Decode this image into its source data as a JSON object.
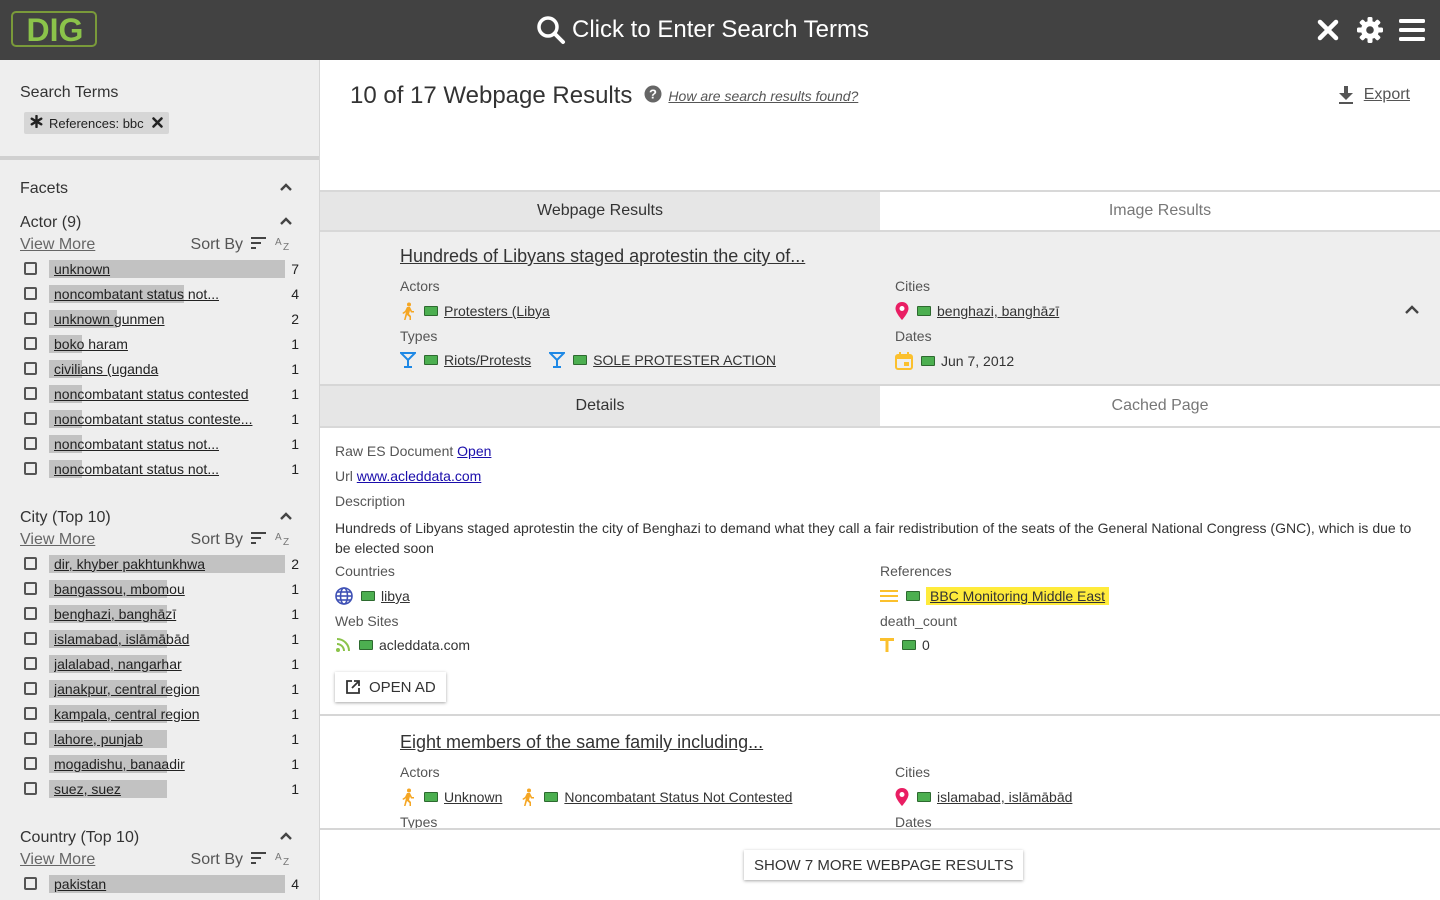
{
  "app": {
    "logo_text": "DIG"
  },
  "header": {
    "search_prompt": "Click to Enter Search Terms"
  },
  "sidebar": {
    "search_terms_title": "Search Terms",
    "chip_label": "References: bbc",
    "facets_title": "Facets",
    "sort_by_label": "Sort By",
    "view_more_label": "View More",
    "actor": {
      "title": "Actor (9)",
      "items": [
        {
          "label": "unknown",
          "count": "7",
          "fraction": 1.0
        },
        {
          "label": "noncombatant status not...",
          "count": "4",
          "fraction": 0.57
        },
        {
          "label": "unknown gunmen",
          "count": "2",
          "fraction": 0.29
        },
        {
          "label": "boko haram",
          "count": "1",
          "fraction": 0.14
        },
        {
          "label": "civilians (uganda",
          "count": "1",
          "fraction": 0.14
        },
        {
          "label": "noncombatant status contested",
          "count": "1",
          "fraction": 0.14
        },
        {
          "label": "noncombatant status conteste...",
          "count": "1",
          "fraction": 0.14
        },
        {
          "label": "noncombatant status not...",
          "count": "1",
          "fraction": 0.14
        },
        {
          "label": "noncombatant status not...",
          "count": "1",
          "fraction": 0.14
        }
      ]
    },
    "city": {
      "title": "City (Top 10)",
      "items": [
        {
          "label": "dir, khyber pakhtunkhwa",
          "count": "2",
          "fraction": 1.0
        },
        {
          "label": "bangassou, mbomou",
          "count": "1",
          "fraction": 0.5
        },
        {
          "label": "benghazi, banghāzī",
          "count": "1",
          "fraction": 0.5
        },
        {
          "label": "islamabad, islāmābād",
          "count": "1",
          "fraction": 0.5
        },
        {
          "label": "jalalabad, nangarhar",
          "count": "1",
          "fraction": 0.5
        },
        {
          "label": "janakpur, central region",
          "count": "1",
          "fraction": 0.5
        },
        {
          "label": "kampala, central region",
          "count": "1",
          "fraction": 0.5
        },
        {
          "label": "lahore, punjab",
          "count": "1",
          "fraction": 0.5
        },
        {
          "label": "mogadishu, banaadir",
          "count": "1",
          "fraction": 0.5
        },
        {
          "label": "suez, suez",
          "count": "1",
          "fraction": 0.5
        }
      ]
    },
    "country": {
      "title": "Country (Top 10)",
      "items": [
        {
          "label": "pakistan",
          "count": "4",
          "fraction": 1.0
        }
      ]
    }
  },
  "main": {
    "results_title": "10 of 17 Webpage Results",
    "help_link": "How are search results found?",
    "export_label": "Export",
    "tabs": {
      "webpage": "Webpage Results",
      "image": "Image Results"
    },
    "result1": {
      "title": "Hundreds of Libyans staged aprotestin the city of...",
      "actors_label": "Actors",
      "actor_value": "Protesters (Libya",
      "types_label": "Types",
      "type_1": "Riots/Protests",
      "type_2": "SOLE PROTESTER ACTION",
      "cities_label": "Cities",
      "city_value": "benghazi, banghāzī",
      "dates_label": "Dates",
      "date_value": "Jun 7, 2012"
    },
    "detail_tabs": {
      "details": "Details",
      "cached": "Cached Page"
    },
    "details": {
      "raw_label": "Raw ES Document",
      "raw_link": "Open",
      "url_label": "Url",
      "url_value": "www.acleddata.com",
      "description_label": "Description",
      "description": "Hundreds of Libyans staged aprotestin the city of Benghazi to demand what they call a fair redistribution of the seats of the General National Congress (GNC), which is due to be elected soon",
      "countries_label": "Countries",
      "country_value": "libya",
      "references_label": "References",
      "reference_value": "BBC Monitoring Middle East",
      "websites_label": "Web Sites",
      "website_value": "acleddata.com",
      "death_count_label": "death_count",
      "death_count_value": "0",
      "open_ad_label": "OPEN AD"
    },
    "result2": {
      "title": "Eight members of the same family including...",
      "actors_label": "Actors",
      "actor_1": "Unknown",
      "actor_2": "Noncombatant Status Not Contested",
      "types_label": "Types",
      "cities_label": "Cities",
      "city_value": "islamabad, islāmābād",
      "dates_label": "Dates"
    },
    "show_more_label": "SHOW 7 MORE WEBPAGE RESULTS"
  },
  "colors": {
    "topbar": "#424242",
    "logo": "#8bc34a",
    "actor_icon": "#f5a623",
    "type_icon": "#1e88e5",
    "city_icon": "#e91e63",
    "date_icon": "#fbc02d",
    "country_icon": "#3f51b5",
    "reference_icon": "#fbc02d",
    "website_icon": "#8bc34a",
    "highlight": "#ffeb3b"
  }
}
